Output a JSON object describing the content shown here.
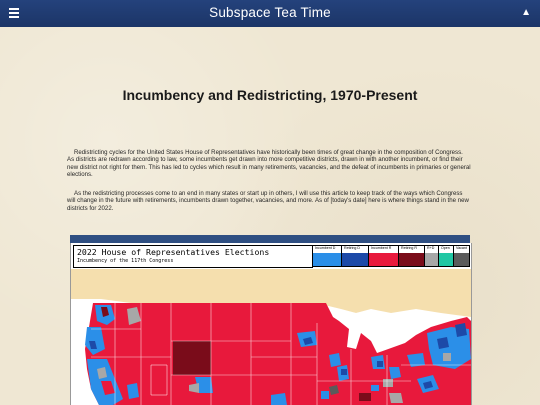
{
  "header": {
    "site_title": "Subspace Tea Time",
    "menu_icon": "hamburger-menu-icon",
    "user_icon": "user-icon",
    "bar_color": "#203d74"
  },
  "article": {
    "title": "Incumbency and Redistricting, 1970-Present",
    "paragraphs": [
      "Redistricting cycles for the United States House of Representatives have historically been times of great change in the composition of Congress. As districts are redrawn according to law, some incumbents get drawn into more competitive districts, drawn in with another incumbent, or find their new district not right for them. This has led to cycles which result in many retirements, vacancies, and the defeat of incumbents in primaries or general elections.",
      "As the redistricting processes come to an end in many states or start up in others, I will use this article to keep track of the ways which Congress will change in the future with retirements, incumbents drawn together, vacancies, and more. As of [today's date] here is where things stand in the new districts for 2022."
    ]
  },
  "map": {
    "title": "2022 House of Representatives Elections",
    "subtitle": "Incumbency of the 117th Congress",
    "legend": [
      {
        "label": "Incumbent D",
        "color": "#2b8fe8"
      },
      {
        "label": "Retiring D",
        "color": "#1d4aa8"
      },
      {
        "label": "Incumbent R",
        "color": "#e8193c"
      },
      {
        "label": "Retiring R",
        "color": "#7a0c1a"
      },
      {
        "label": "R+D",
        "color": "#a7a7a7"
      },
      {
        "label": "Open",
        "color": "#21c7a4"
      },
      {
        "label": "Vacant",
        "color": "#5b5b5b"
      }
    ],
    "colors": {
      "water": "#ffffff",
      "canada": "#f5dfae",
      "republican": "#e8193c",
      "retiring_r": "#7a0c1a",
      "democrat": "#2b8fe8",
      "retiring_d": "#1d4aa8",
      "both": "#a7a7a7"
    }
  }
}
